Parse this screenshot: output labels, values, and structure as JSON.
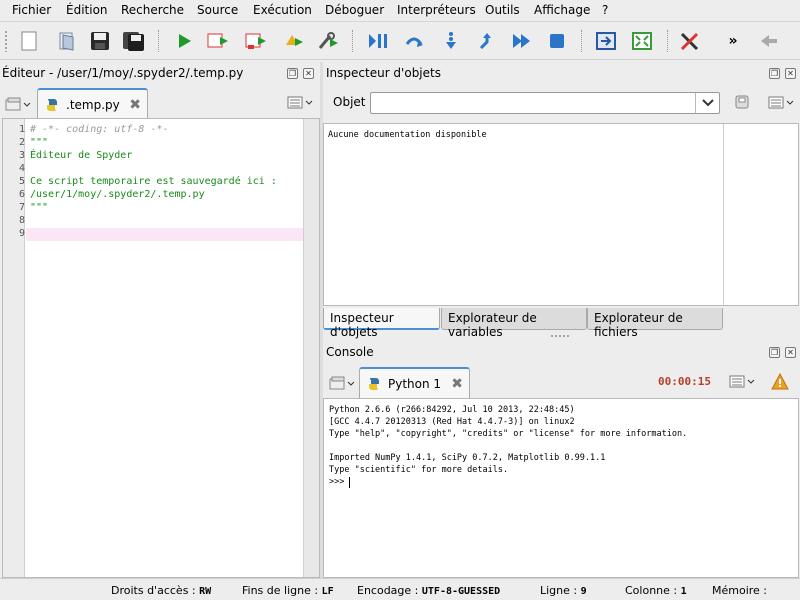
{
  "menu": [
    "Fichier",
    "Édition",
    "Recherche",
    "Source",
    "Exécution",
    "Déboguer",
    "Interpréteurs",
    "Outils",
    "Affichage",
    "?"
  ],
  "toolbar": {
    "icons": [
      "new-file-icon",
      "open-file-icon",
      "save-icon",
      "save-all-icon",
      "run-icon",
      "run-selection-icon",
      "run-cell-icon",
      "debug-icon",
      "configure-run-icon",
      "debug-continue-icon",
      "step-icon",
      "step-into-icon",
      "step-return-icon",
      "continue-icon",
      "stop-icon",
      "maximize-pane-icon",
      "fullscreen-icon",
      "preferences-icon",
      "more-icon",
      "back-icon"
    ],
    "more_label": "»"
  },
  "editor": {
    "title": "Éditeur - /user/1/moy/.spyder2/.temp.py",
    "tab_label": ".temp.py",
    "lines": [
      {
        "n": "1",
        "text": "# -*- coding: utf-8 -*-",
        "kind": "comment"
      },
      {
        "n": "2",
        "text": "\"\"\"",
        "kind": "string"
      },
      {
        "n": "3",
        "text": "Éditeur de Spyder",
        "kind": "string"
      },
      {
        "n": "4",
        "text": "",
        "kind": "string"
      },
      {
        "n": "5",
        "text": "Ce script temporaire est sauvegardé ici :",
        "kind": "string"
      },
      {
        "n": "6",
        "text": "/user/1/moy/.spyder2/.temp.py",
        "kind": "string"
      },
      {
        "n": "7",
        "text": "\"\"\"",
        "kind": "string"
      },
      {
        "n": "8",
        "text": "",
        "kind": "string"
      },
      {
        "n": "9",
        "text": "",
        "kind": "string"
      }
    ]
  },
  "inspector": {
    "title": "Inspecteur d'objets",
    "object_label": "Objet",
    "object_value": "",
    "doc_text": "Aucune documentation disponible",
    "tabs": [
      "Inspecteur d'objets",
      "Explorateur de variables",
      "Explorateur de fichiers"
    ],
    "active_tab": 0
  },
  "console": {
    "title": "Console",
    "tab_label": "Python 1",
    "timer": "00:00:15",
    "lines": [
      "Python 2.6.6 (r266:84292, Jul 10 2013, 22:48:45)",
      "[GCC 4.4.7 20120313 (Red Hat 4.4.7-3)] on linux2",
      "Type \"help\", \"copyright\", \"credits\" or \"license\" for more information.",
      "",
      "Imported NumPy 1.4.1, SciPy 0.7.2, Matplotlib 0.99.1.1",
      "Type \"scientific\" for more details.",
      ">>> "
    ]
  },
  "status": {
    "access_label": "Droits d'accès :",
    "access_value": "RW",
    "eol_label": "Fins de ligne :",
    "eol_value": "LF",
    "encoding_label": "Encodage :",
    "encoding_value": "UTF-8-GUESSED",
    "line_label": "Ligne :",
    "line_value": "9",
    "col_label": "Colonne :",
    "col_value": "1",
    "mem_label": "Mémoire :"
  },
  "colors": {
    "accent": "#4a90d9",
    "string": "#1a8a1a",
    "comment": "#9a9a9a",
    "timer": "#b3402a",
    "current_line": "#fbe6f5"
  }
}
